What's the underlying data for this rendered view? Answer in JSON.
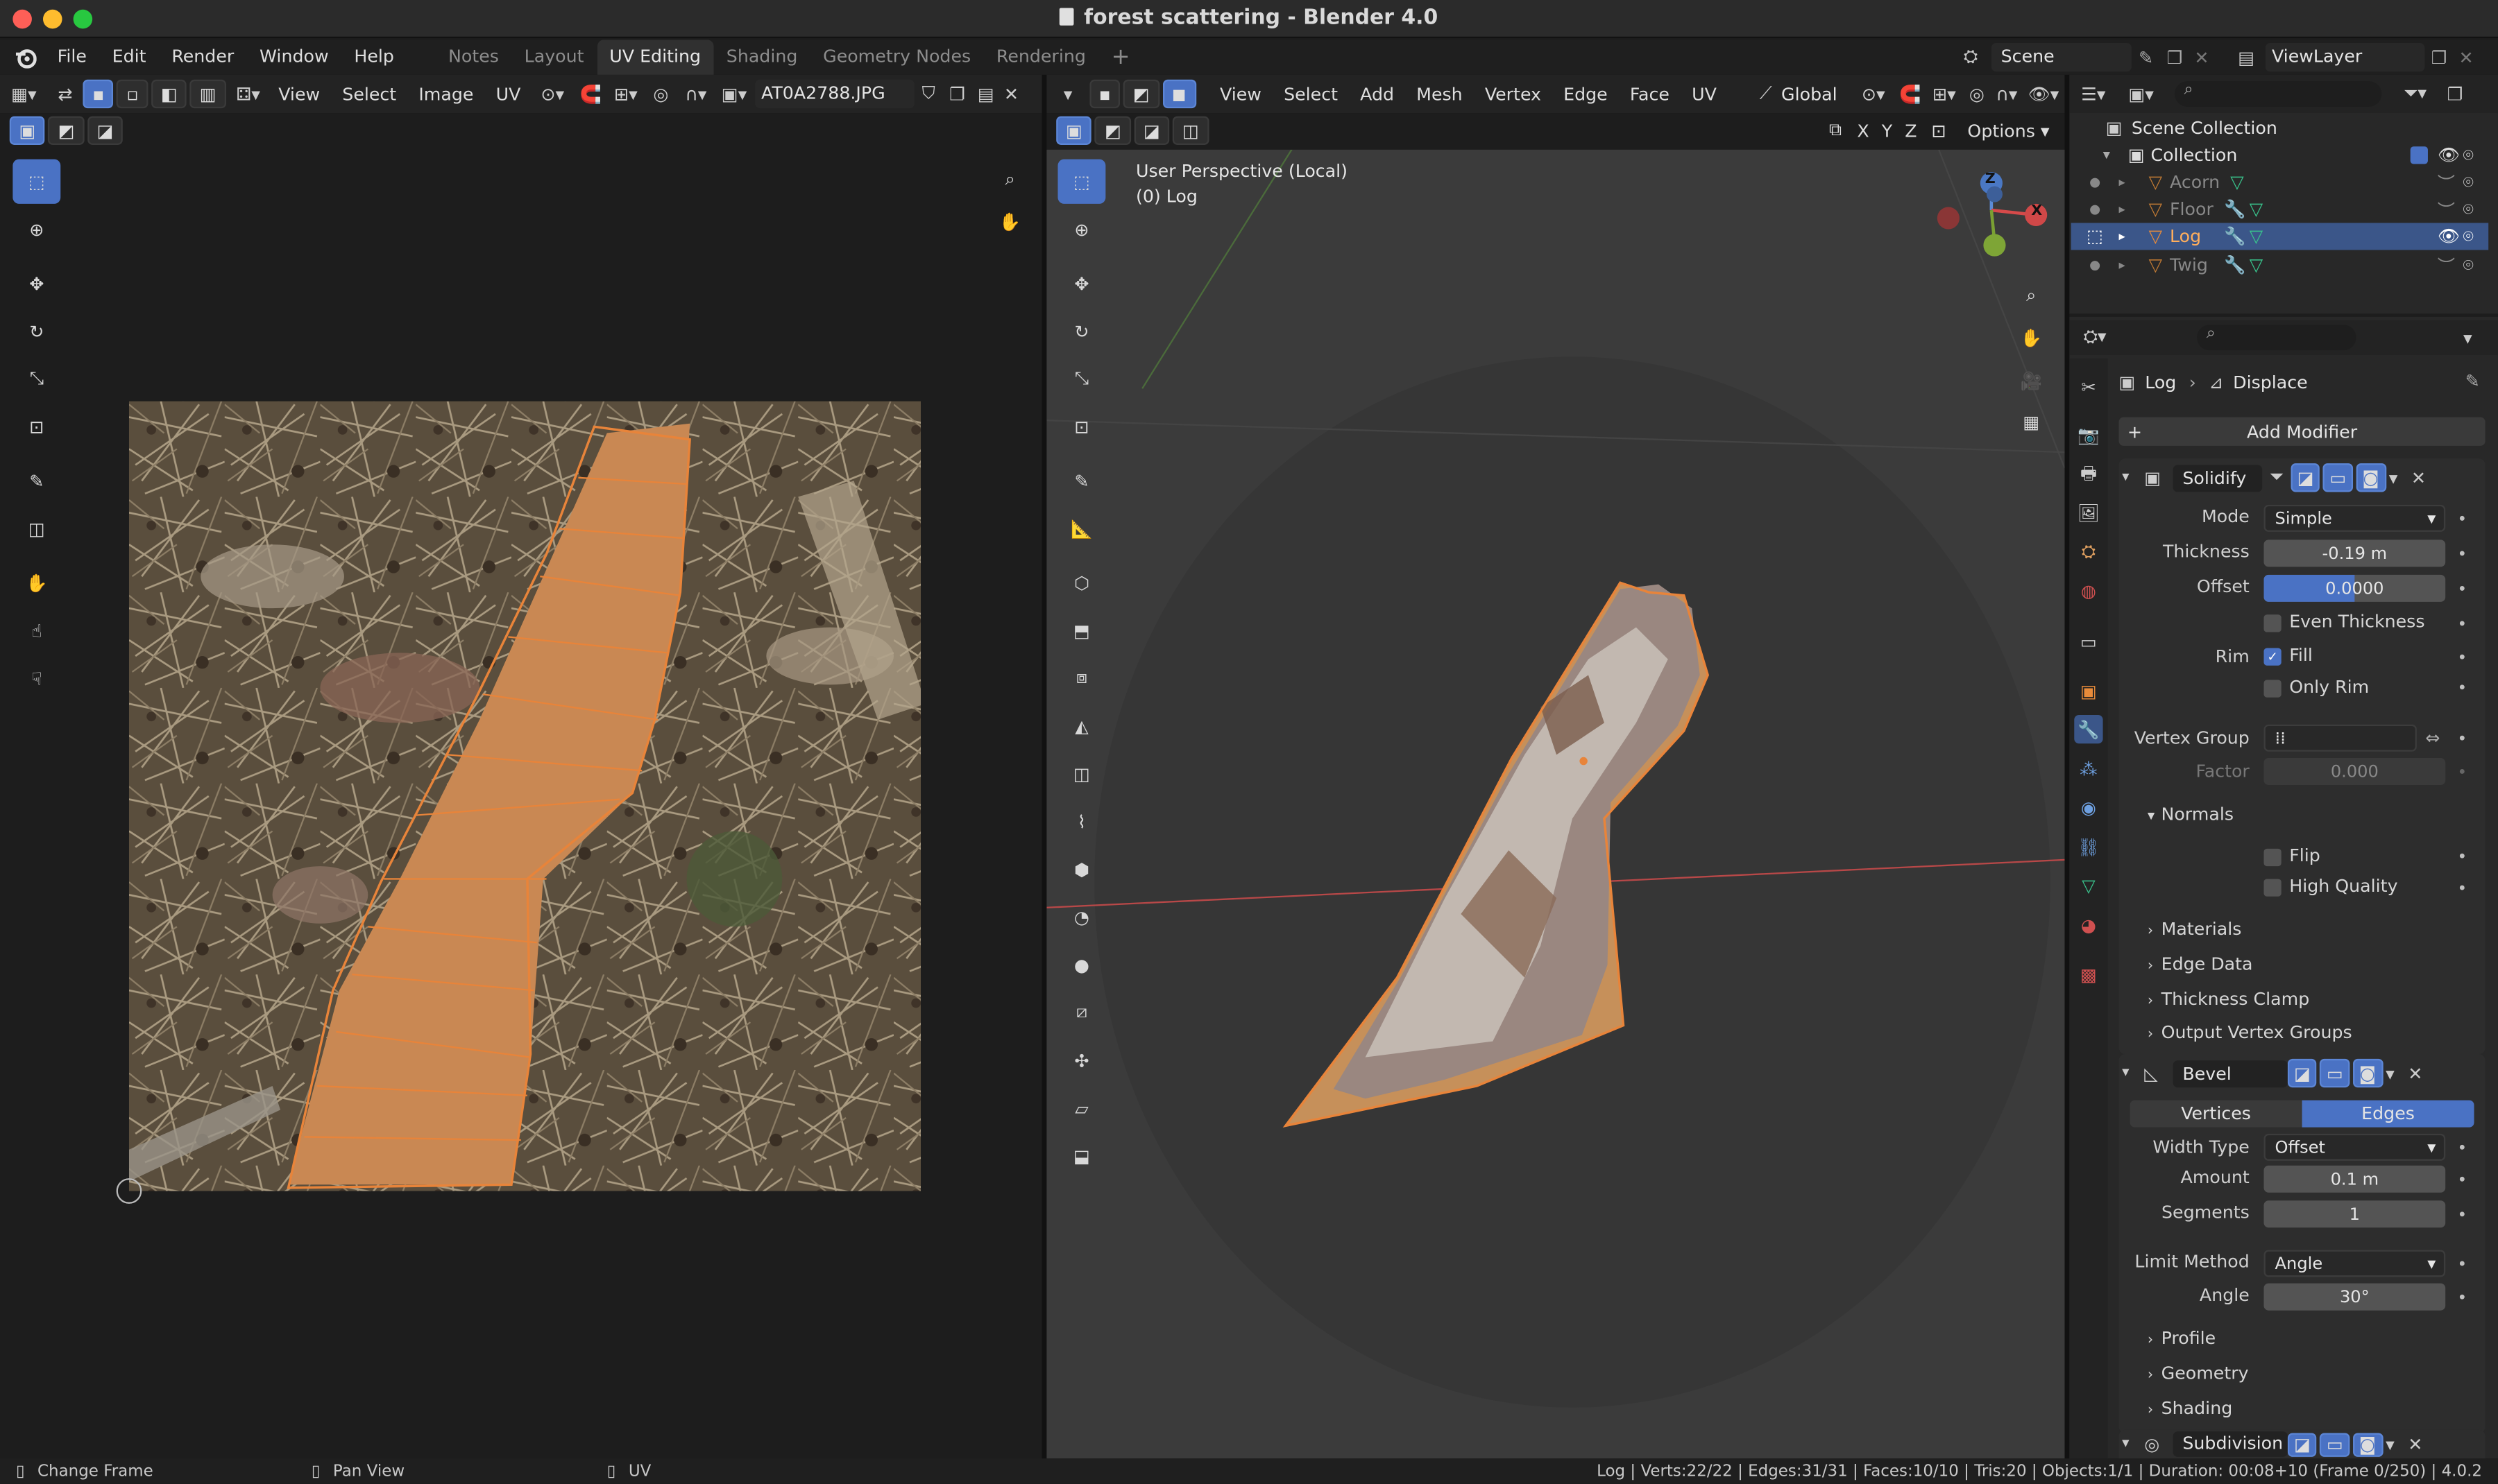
{
  "window": {
    "title": "forest scattering - Blender 4.0"
  },
  "menus": [
    "File",
    "Edit",
    "Render",
    "Window",
    "Help"
  ],
  "workspaces": [
    {
      "label": "Notes"
    },
    {
      "label": "Layout"
    },
    {
      "label": "UV Editing",
      "active": true
    },
    {
      "label": "Shading"
    },
    {
      "label": "Geometry Nodes"
    },
    {
      "label": "Rendering"
    }
  ],
  "scene": {
    "label": "Scene"
  },
  "view_layer": {
    "label": "ViewLayer"
  },
  "uv_editor": {
    "menus": [
      "View",
      "Select",
      "Image",
      "UV"
    ],
    "image_name": "AT0A2788.JPG"
  },
  "viewport3d": {
    "menus": [
      "View",
      "Select",
      "Add",
      "Mesh",
      "Vertex",
      "Edge",
      "Face",
      "UV"
    ],
    "orientation": "Global",
    "axes": [
      "X",
      "Y",
      "Z"
    ],
    "options_label": "Options",
    "overlay_line1": "User Perspective (Local)",
    "overlay_line2": "(0) Log",
    "gizmo": {
      "x": "X",
      "y": "Y",
      "z": "Z"
    }
  },
  "outliner": {
    "root": "Scene Collection",
    "collection": "Collection",
    "objects": [
      {
        "name": "Acorn",
        "selected": false
      },
      {
        "name": "Floor",
        "selected": false
      },
      {
        "name": "Log",
        "selected": true
      },
      {
        "name": "Twig",
        "selected": false
      }
    ]
  },
  "properties": {
    "breadcrumb_object": "Log",
    "breadcrumb_modifier": "Displace",
    "add_modifier": "Add Modifier",
    "solidify": {
      "name": "Solidify",
      "mode_label": "Mode",
      "mode": "Simple",
      "thickness_label": "Thickness",
      "thickness": "-0.19 m",
      "offset_label": "Offset",
      "offset": "0.0000",
      "offset_fill": 0.5,
      "even_thickness": "Even Thickness",
      "rim_label": "Rim",
      "fill": "Fill",
      "only_rim": "Only Rim",
      "vertex_group_label": "Vertex Group",
      "factor_label": "Factor",
      "factor": "0.000",
      "normals": "Normals",
      "flip": "Flip",
      "high_quality": "High Quality",
      "sections": [
        "Materials",
        "Edge Data",
        "Thickness Clamp",
        "Output Vertex Groups"
      ]
    },
    "bevel": {
      "name": "Bevel",
      "tab_vertices": "Vertices",
      "tab_edges": "Edges",
      "width_type_label": "Width Type",
      "width_type": "Offset",
      "amount_label": "Amount",
      "amount": "0.1 m",
      "segments_label": "Segments",
      "segments": "1",
      "limit_method_label": "Limit Method",
      "limit_method": "Angle",
      "angle_label": "Angle",
      "angle": "30°",
      "sections": [
        "Profile",
        "Geometry",
        "Shading"
      ]
    },
    "subdivision": {
      "name": "Subdivision"
    }
  },
  "status": {
    "left1": "Change Frame",
    "left2": "Pan View",
    "left3": "UV",
    "stats": "Log | Verts:22/22 | Edges:31/31 | Faces:10/10 | Tris:20 | Objects:1/1 | Duration: 00:08+10 (Frame 0/250) | 4.0.2"
  },
  "colors": {
    "accent": "#4a72c4",
    "selection_orange": "#e8843a",
    "background": "#1d1d1d",
    "viewport": "#3b3b3b"
  }
}
